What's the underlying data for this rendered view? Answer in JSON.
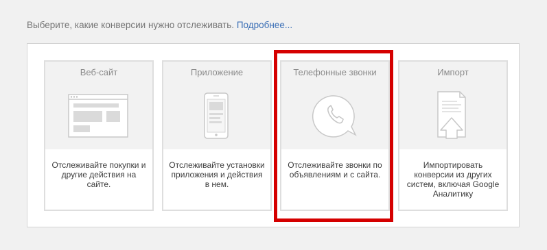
{
  "intro": {
    "text": "Выберите, какие конверсии нужно отслеживать.",
    "link": "Подробнее..."
  },
  "cards": [
    {
      "title": "Веб-сайт",
      "icon": "website-icon",
      "desc": "Отслеживайте покупки и другие действия на сайте."
    },
    {
      "title": "Приложение",
      "icon": "mobile-app-icon",
      "desc": "Отслеживайте установки приложения и действия в нем."
    },
    {
      "title": "Телефонные звонки",
      "icon": "phone-call-icon",
      "desc": "Отслеживайте звонки по объявлениям и с сайта.",
      "highlighted": true
    },
    {
      "title": "Импорт",
      "icon": "import-icon",
      "desc": "Импортировать конверсии из других систем, включая Google Аналитику"
    }
  ],
  "colors": {
    "highlight": "#d50000",
    "link": "#3b6fb6",
    "card_top": "#f2f2f2"
  }
}
